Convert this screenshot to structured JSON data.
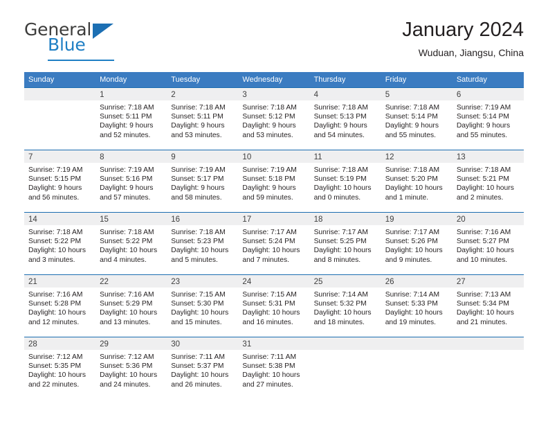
{
  "brand": {
    "name_top": "General",
    "name_bottom": "Blue",
    "accent_color": "#1f7fc4"
  },
  "header": {
    "title": "January 2024",
    "subtitle": "Wuduan, Jiangsu, China"
  },
  "theme": {
    "header_bar_color": "#3b7cc1",
    "row_divider_color": "#1a6cb0",
    "day_band_color": "#efeff0",
    "text_color": "#231f20"
  },
  "calendar": {
    "weekdays": [
      "Sunday",
      "Monday",
      "Tuesday",
      "Wednesday",
      "Thursday",
      "Friday",
      "Saturday"
    ],
    "weeks": [
      [
        {
          "day": "",
          "lines": []
        },
        {
          "day": "1",
          "lines": [
            "Sunrise: 7:18 AM",
            "Sunset: 5:11 PM",
            "Daylight: 9 hours",
            "and 52 minutes."
          ]
        },
        {
          "day": "2",
          "lines": [
            "Sunrise: 7:18 AM",
            "Sunset: 5:11 PM",
            "Daylight: 9 hours",
            "and 53 minutes."
          ]
        },
        {
          "day": "3",
          "lines": [
            "Sunrise: 7:18 AM",
            "Sunset: 5:12 PM",
            "Daylight: 9 hours",
            "and 53 minutes."
          ]
        },
        {
          "day": "4",
          "lines": [
            "Sunrise: 7:18 AM",
            "Sunset: 5:13 PM",
            "Daylight: 9 hours",
            "and 54 minutes."
          ]
        },
        {
          "day": "5",
          "lines": [
            "Sunrise: 7:18 AM",
            "Sunset: 5:14 PM",
            "Daylight: 9 hours",
            "and 55 minutes."
          ]
        },
        {
          "day": "6",
          "lines": [
            "Sunrise: 7:19 AM",
            "Sunset: 5:14 PM",
            "Daylight: 9 hours",
            "and 55 minutes."
          ]
        }
      ],
      [
        {
          "day": "7",
          "lines": [
            "Sunrise: 7:19 AM",
            "Sunset: 5:15 PM",
            "Daylight: 9 hours",
            "and 56 minutes."
          ]
        },
        {
          "day": "8",
          "lines": [
            "Sunrise: 7:19 AM",
            "Sunset: 5:16 PM",
            "Daylight: 9 hours",
            "and 57 minutes."
          ]
        },
        {
          "day": "9",
          "lines": [
            "Sunrise: 7:19 AM",
            "Sunset: 5:17 PM",
            "Daylight: 9 hours",
            "and 58 minutes."
          ]
        },
        {
          "day": "10",
          "lines": [
            "Sunrise: 7:19 AM",
            "Sunset: 5:18 PM",
            "Daylight: 9 hours",
            "and 59 minutes."
          ]
        },
        {
          "day": "11",
          "lines": [
            "Sunrise: 7:18 AM",
            "Sunset: 5:19 PM",
            "Daylight: 10 hours",
            "and 0 minutes."
          ]
        },
        {
          "day": "12",
          "lines": [
            "Sunrise: 7:18 AM",
            "Sunset: 5:20 PM",
            "Daylight: 10 hours",
            "and 1 minute."
          ]
        },
        {
          "day": "13",
          "lines": [
            "Sunrise: 7:18 AM",
            "Sunset: 5:21 PM",
            "Daylight: 10 hours",
            "and 2 minutes."
          ]
        }
      ],
      [
        {
          "day": "14",
          "lines": [
            "Sunrise: 7:18 AM",
            "Sunset: 5:22 PM",
            "Daylight: 10 hours",
            "and 3 minutes."
          ]
        },
        {
          "day": "15",
          "lines": [
            "Sunrise: 7:18 AM",
            "Sunset: 5:22 PM",
            "Daylight: 10 hours",
            "and 4 minutes."
          ]
        },
        {
          "day": "16",
          "lines": [
            "Sunrise: 7:18 AM",
            "Sunset: 5:23 PM",
            "Daylight: 10 hours",
            "and 5 minutes."
          ]
        },
        {
          "day": "17",
          "lines": [
            "Sunrise: 7:17 AM",
            "Sunset: 5:24 PM",
            "Daylight: 10 hours",
            "and 7 minutes."
          ]
        },
        {
          "day": "18",
          "lines": [
            "Sunrise: 7:17 AM",
            "Sunset: 5:25 PM",
            "Daylight: 10 hours",
            "and 8 minutes."
          ]
        },
        {
          "day": "19",
          "lines": [
            "Sunrise: 7:17 AM",
            "Sunset: 5:26 PM",
            "Daylight: 10 hours",
            "and 9 minutes."
          ]
        },
        {
          "day": "20",
          "lines": [
            "Sunrise: 7:16 AM",
            "Sunset: 5:27 PM",
            "Daylight: 10 hours",
            "and 10 minutes."
          ]
        }
      ],
      [
        {
          "day": "21",
          "lines": [
            "Sunrise: 7:16 AM",
            "Sunset: 5:28 PM",
            "Daylight: 10 hours",
            "and 12 minutes."
          ]
        },
        {
          "day": "22",
          "lines": [
            "Sunrise: 7:16 AM",
            "Sunset: 5:29 PM",
            "Daylight: 10 hours",
            "and 13 minutes."
          ]
        },
        {
          "day": "23",
          "lines": [
            "Sunrise: 7:15 AM",
            "Sunset: 5:30 PM",
            "Daylight: 10 hours",
            "and 15 minutes."
          ]
        },
        {
          "day": "24",
          "lines": [
            "Sunrise: 7:15 AM",
            "Sunset: 5:31 PM",
            "Daylight: 10 hours",
            "and 16 minutes."
          ]
        },
        {
          "day": "25",
          "lines": [
            "Sunrise: 7:14 AM",
            "Sunset: 5:32 PM",
            "Daylight: 10 hours",
            "and 18 minutes."
          ]
        },
        {
          "day": "26",
          "lines": [
            "Sunrise: 7:14 AM",
            "Sunset: 5:33 PM",
            "Daylight: 10 hours",
            "and 19 minutes."
          ]
        },
        {
          "day": "27",
          "lines": [
            "Sunrise: 7:13 AM",
            "Sunset: 5:34 PM",
            "Daylight: 10 hours",
            "and 21 minutes."
          ]
        }
      ],
      [
        {
          "day": "28",
          "lines": [
            "Sunrise: 7:12 AM",
            "Sunset: 5:35 PM",
            "Daylight: 10 hours",
            "and 22 minutes."
          ]
        },
        {
          "day": "29",
          "lines": [
            "Sunrise: 7:12 AM",
            "Sunset: 5:36 PM",
            "Daylight: 10 hours",
            "and 24 minutes."
          ]
        },
        {
          "day": "30",
          "lines": [
            "Sunrise: 7:11 AM",
            "Sunset: 5:37 PM",
            "Daylight: 10 hours",
            "and 26 minutes."
          ]
        },
        {
          "day": "31",
          "lines": [
            "Sunrise: 7:11 AM",
            "Sunset: 5:38 PM",
            "Daylight: 10 hours",
            "and 27 minutes."
          ]
        },
        {
          "day": "",
          "lines": []
        },
        {
          "day": "",
          "lines": []
        },
        {
          "day": "",
          "lines": []
        }
      ]
    ]
  }
}
